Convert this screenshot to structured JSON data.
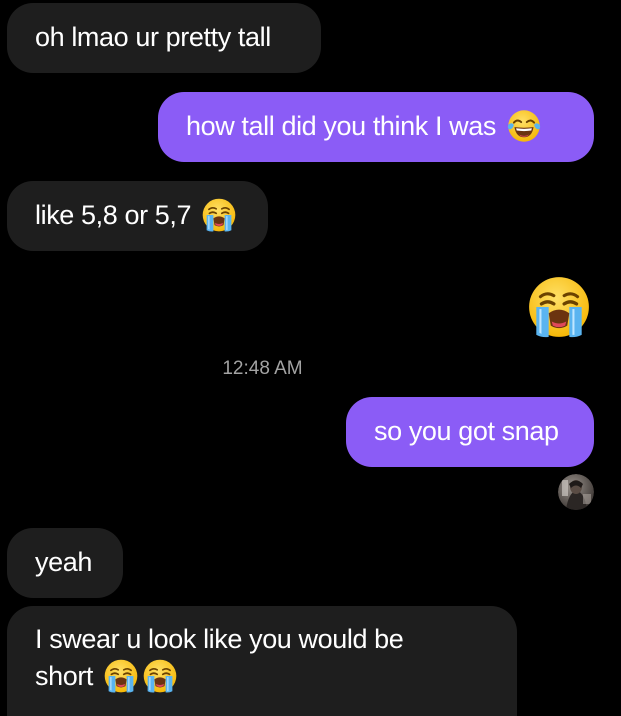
{
  "conversation": {
    "messages": [
      {
        "direction": "incoming",
        "text": "oh lmao ur pretty tall",
        "emojis": []
      },
      {
        "direction": "outgoing",
        "text": "how tall did you think I was",
        "emojis": [
          "face-with-tears-of-joy"
        ]
      },
      {
        "direction": "incoming",
        "text": "like 5,8 or 5,7",
        "emojis": [
          "loudly-crying-face"
        ]
      },
      {
        "direction": "outgoing",
        "text": "",
        "emojis": [
          "loudly-crying-face"
        ]
      },
      {
        "direction": "outgoing",
        "text": "so you got snap",
        "emojis": []
      },
      {
        "direction": "incoming",
        "text": "yeah",
        "emojis": []
      },
      {
        "direction": "incoming",
        "text_line1": "I swear u look like you would be",
        "text_line2": "short",
        "emojis": [
          "loudly-crying-face",
          "loudly-crying-face"
        ]
      }
    ],
    "timestamp": "12:48 AM"
  },
  "colors": {
    "background": "#000000",
    "incoming_bubble": "#1e1e1e",
    "outgoing_bubble": "#8b5cf6",
    "text": "#ffffff",
    "timestamp": "#a3a3a3",
    "emoji_yellow": "#ffcc33",
    "emoji_tears": "#5ab4f0"
  },
  "icons": {
    "seen_avatar": "seen-avatar-photo"
  }
}
